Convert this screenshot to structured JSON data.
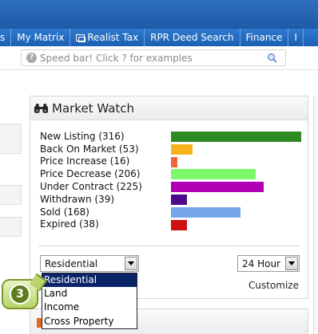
{
  "nav": {
    "items": [
      {
        "label": "s"
      },
      {
        "label": "My Matrix"
      },
      {
        "label": "Realist Tax",
        "icon": "window-icon"
      },
      {
        "label": "RPR Deed Search"
      },
      {
        "label": "Finance"
      },
      {
        "label": "I"
      }
    ]
  },
  "speedbar": {
    "placeholder": "Speed bar! Click ? for examples",
    "help_icon": "?",
    "search_icon": "magnifier-icon"
  },
  "market_watch": {
    "title": "Market Watch",
    "icon": "binoculars-icon",
    "stats": [
      {
        "label": "New Listing (316)",
        "value": 316,
        "color": "#2e8b22"
      },
      {
        "label": "Back On Market (53)",
        "value": 53,
        "color": "#f8b31c"
      },
      {
        "label": "Price Increase (16)",
        "value": 16,
        "color": "#f2653a"
      },
      {
        "label": "Price Decrease (206)",
        "value": 206,
        "color": "#7cf86b"
      },
      {
        "label": "Under Contract (225)",
        "value": 225,
        "color": "#b000b6"
      },
      {
        "label": "Withdrawn (39)",
        "value": 39,
        "color": "#4b0a8a"
      },
      {
        "label": "Sold (168)",
        "value": 168,
        "color": "#74a6e9"
      },
      {
        "label": "Expired (38)",
        "value": 38,
        "color": "#cf1010"
      }
    ],
    "property_select": {
      "value": "Residential",
      "options": [
        "Residential",
        "Land",
        "Income",
        "Cross Property"
      ]
    },
    "time_select": {
      "value": "24 Hour"
    },
    "customize_label": "Customize"
  },
  "callout": {
    "number": "3"
  }
}
